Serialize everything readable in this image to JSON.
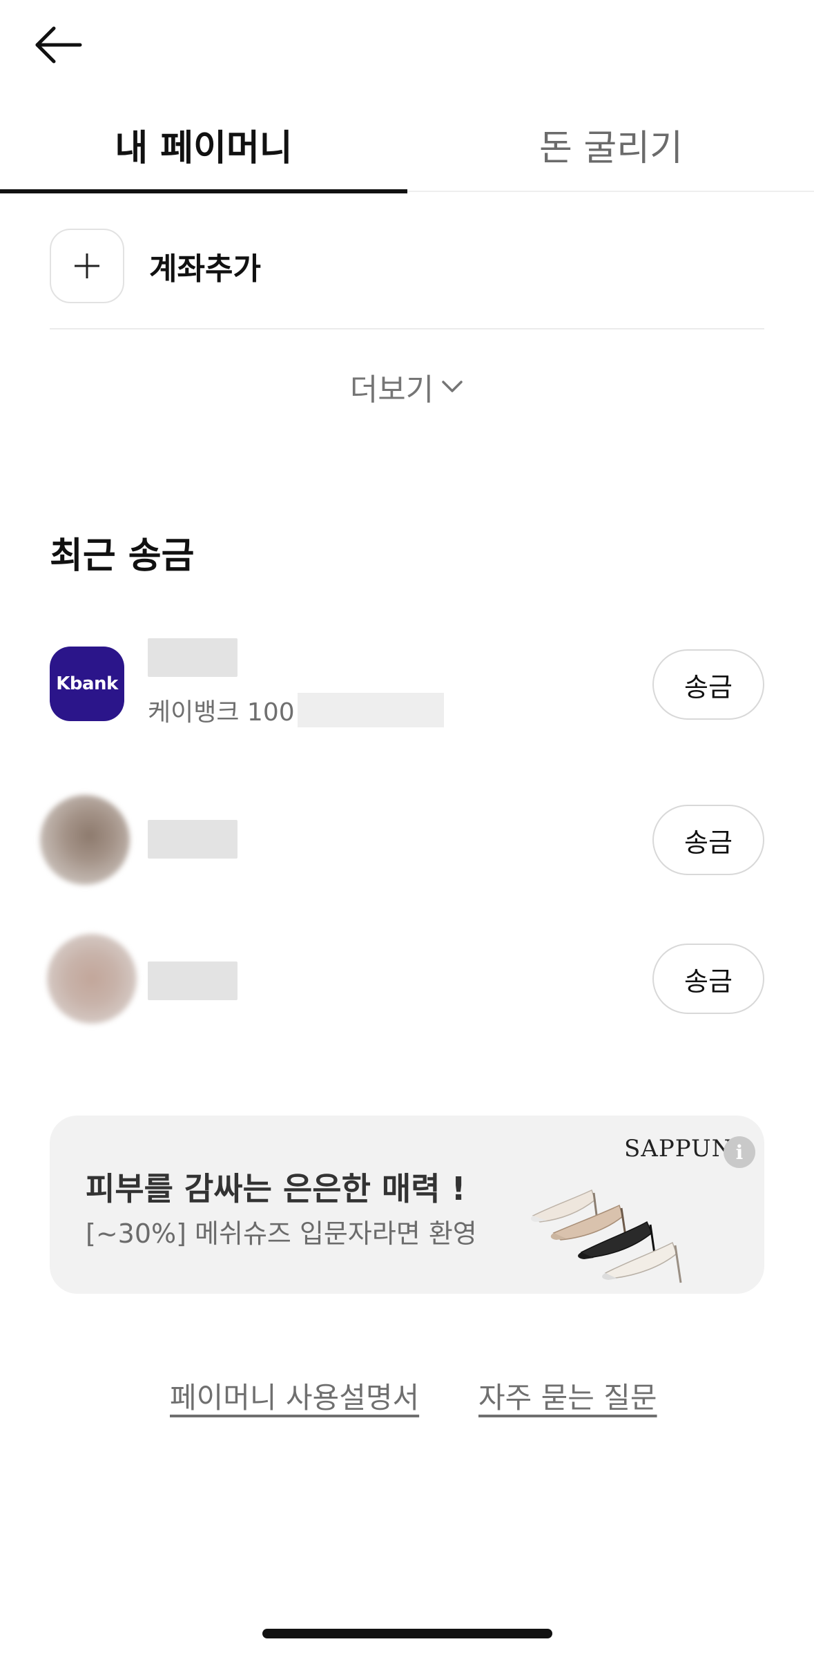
{
  "header": {
    "back_icon": "arrow-left-icon"
  },
  "tabs": [
    {
      "label": "내 페이머니",
      "active": true
    },
    {
      "label": "돈 굴리기",
      "active": false
    }
  ],
  "account": {
    "add_label": "계좌추가",
    "add_icon": "plus-icon",
    "more_label": "더보기",
    "more_icon": "chevron-down-icon"
  },
  "recent": {
    "title": "최근 송금",
    "items": [
      {
        "logo_text": "Kbank",
        "sub_text": "케이뱅크 100",
        "send_label": "송금",
        "logo_color": "#2b158a"
      },
      {
        "send_label": "송금"
      },
      {
        "send_label": "송금"
      }
    ]
  },
  "ad": {
    "title": "피부를 감싸는 은은한 매력 !",
    "subtitle": "[~30%] 메쉬슈즈 입문자라면 환영",
    "brand": "SAPPUN",
    "info_icon": "info-icon",
    "info_label": "i"
  },
  "footer": {
    "guide_link": "페이머니 사용설명서",
    "faq_link": "자주 묻는 질문"
  }
}
